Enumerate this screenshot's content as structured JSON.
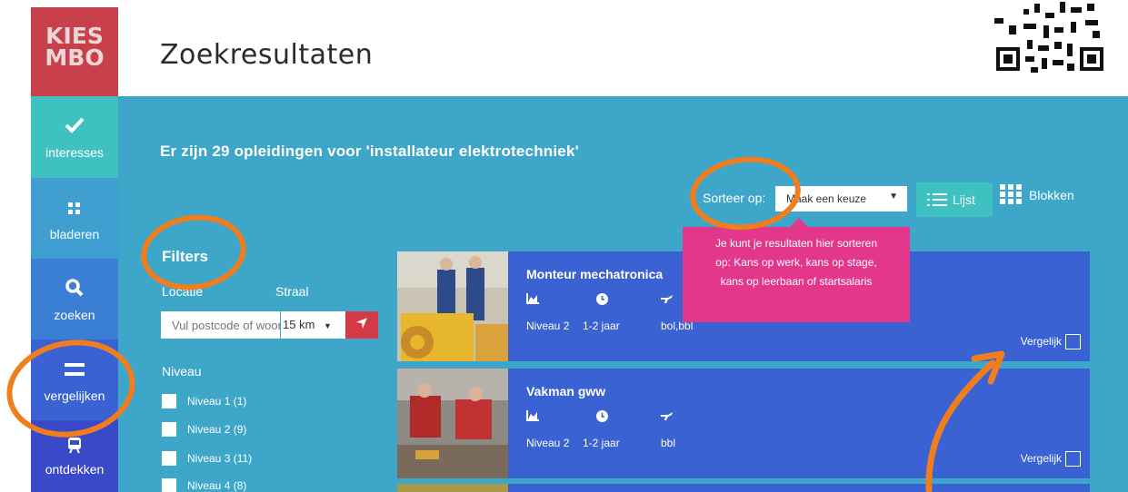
{
  "logo": {
    "line1": "KIES",
    "line2": "MBO"
  },
  "page_title": "Zoekresultaten",
  "sidebar": {
    "items": [
      {
        "label": "interesses",
        "icon": "checkmark-icon"
      },
      {
        "label": "bladeren",
        "icon": "grid-icon"
      },
      {
        "label": "zoeken",
        "icon": "search-icon"
      },
      {
        "label": "vergelijken",
        "icon": "equals-icon"
      },
      {
        "label": "ontdekken",
        "icon": "train-icon"
      }
    ]
  },
  "results_heading": "Er zijn 29 opleidingen voor 'installateur elektrotechniek'",
  "sort": {
    "label": "Sorteer op:",
    "selected": "Maak een keuze"
  },
  "view": {
    "list": "Lijst",
    "blocks": "Blokken"
  },
  "tooltip": [
    "Je kunt je resultaten hier sorteren",
    "op: Kans op werk, kans op stage,",
    "kans op leerbaan of startsalaris"
  ],
  "filters": {
    "title": "Filters",
    "locatie_label": "Locatie",
    "straal_label": "Straal",
    "postcode_placeholder": "Vul postcode of woonplaats in",
    "radius_value": "15 km",
    "niveau_title": "Niveau",
    "niveau_options": [
      "Niveau 1 (1)",
      "Niveau 2 (9)",
      "Niveau 3 (11)",
      "Niveau 4 (8)"
    ]
  },
  "results": [
    {
      "title": "Monteur mechatronica",
      "niveau": "Niveau 2",
      "duur": "1-2 jaar",
      "leerweg": "bol,bbl",
      "compare": "Vergelijk"
    },
    {
      "title": "Vakman gww",
      "niveau": "Niveau 2",
      "duur": "1-2 jaar",
      "leerweg": "bbl",
      "compare": "Vergelijk"
    }
  ],
  "colors": {
    "annotation": "#f07d1e",
    "accent_teal": "#3fc1c2",
    "tooltip": "#e3378c",
    "card": "#3b62d2",
    "logo": "#c8404a"
  }
}
